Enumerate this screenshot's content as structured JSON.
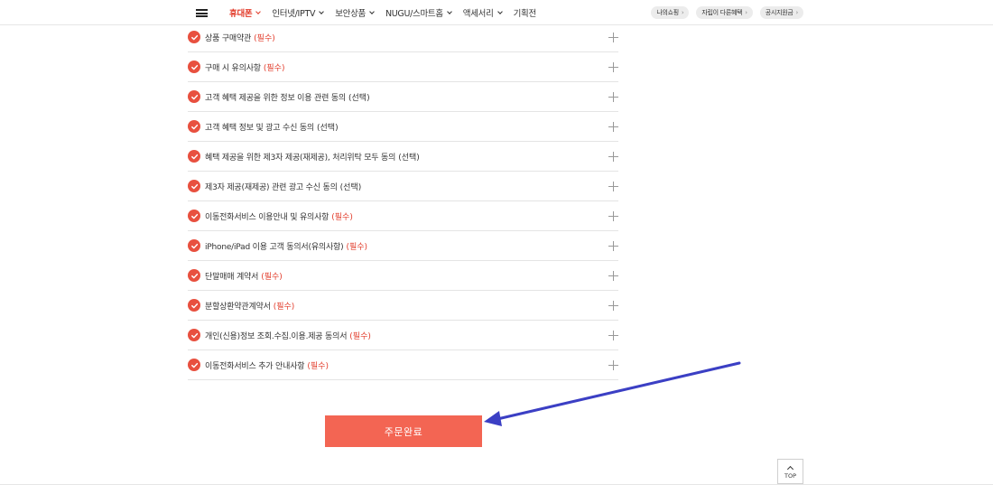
{
  "nav": {
    "items": [
      {
        "label": "휴대폰",
        "active": true,
        "has_dropdown": true
      },
      {
        "label": "인터넷/IPTV",
        "active": false,
        "has_dropdown": true
      },
      {
        "label": "보안상품",
        "active": false,
        "has_dropdown": true
      },
      {
        "label": "NUGU/스마트홈",
        "active": false,
        "has_dropdown": true
      },
      {
        "label": "액세서리",
        "active": false,
        "has_dropdown": true
      },
      {
        "label": "기획전",
        "active": false,
        "has_dropdown": false
      }
    ],
    "quick_links": [
      "나의쇼핑",
      "자립이 다른혜택",
      "공시지원금"
    ]
  },
  "agreements": [
    {
      "label": "상품 구매약관",
      "tag": "(필수)",
      "required": true,
      "checked": true
    },
    {
      "label": "구매 시 유의사항",
      "tag": "(필수)",
      "required": true,
      "checked": true
    },
    {
      "label": "고객 혜택 제공을 위한 정보 이용 관련 동의",
      "tag": "(선택)",
      "required": false,
      "checked": true
    },
    {
      "label": "고객 혜택 정보 및 광고 수신 동의",
      "tag": "(선택)",
      "required": false,
      "checked": true
    },
    {
      "label": "혜택 제공을 위한 제3자 제공(재제공), 처리위탁 모두 동의",
      "tag": "(선택)",
      "required": false,
      "checked": true
    },
    {
      "label": "제3자 제공(재제공) 관련 광고 수신 동의",
      "tag": "(선택)",
      "required": false,
      "checked": true
    },
    {
      "label": "이동전화서비스 이용안내 및 유의사항",
      "tag": "(필수)",
      "required": true,
      "checked": true
    },
    {
      "label": "iPhone/iPad 이용 고객 동의서(유의사항)",
      "tag": "(필수)",
      "required": true,
      "checked": true
    },
    {
      "label": "단말매매 계약서",
      "tag": "(필수)",
      "required": true,
      "checked": true
    },
    {
      "label": "분할상환약관계약서",
      "tag": "(필수)",
      "required": true,
      "checked": true
    },
    {
      "label": "개인(신용)정보 조회.수집.이용.제공 동의서",
      "tag": "(필수)",
      "required": true,
      "checked": true
    },
    {
      "label": "이동전화서비스 추가 안내사항",
      "tag": "(필수)",
      "required": true,
      "checked": true
    }
  ],
  "order_button": {
    "label": "주문완료"
  },
  "top_button": {
    "label": "TOP"
  },
  "colors": {
    "accent": "#e23c2b",
    "check": "#e8503f",
    "button": "#f36553",
    "annotation_arrow": "#3b3fc4"
  },
  "icons": {
    "menu": "hamburger-icon",
    "check": "check-circle-icon",
    "expand": "plus-icon",
    "top": "caret-up-icon"
  }
}
